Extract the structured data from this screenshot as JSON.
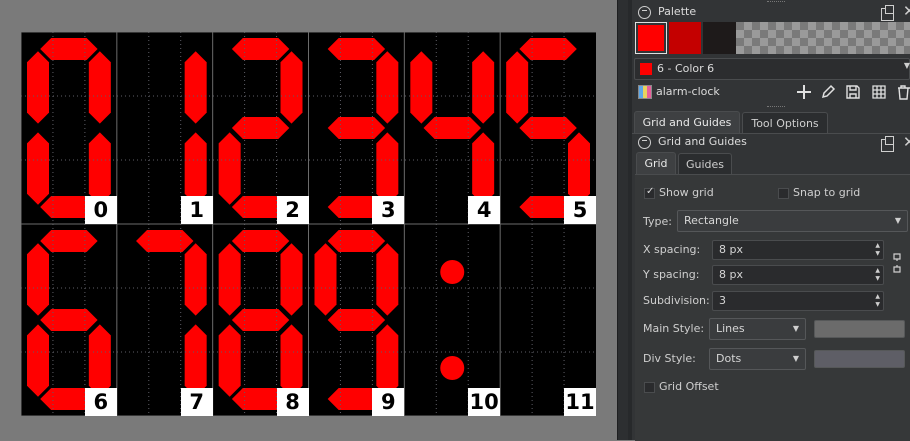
{
  "canvas": {
    "digit_color": "#ff0000",
    "background_color": "#000000",
    "labels": [
      "0",
      "1",
      "2",
      "3",
      "4",
      "5",
      "6",
      "7",
      "8",
      "9",
      "10",
      "11"
    ]
  },
  "palette_docker": {
    "title": "Palette",
    "swatches": [
      "#ff0000",
      "#c40000",
      "#1e1a1a"
    ],
    "current_color_label": "6 - Color 6",
    "current_color": "#ff0000",
    "palette_name": "alarm-clock"
  },
  "tabs_top": [
    {
      "label": "Grid and Guides",
      "active": true
    },
    {
      "label": "Tool Options",
      "active": false
    }
  ],
  "grid_docker": {
    "title": "Grid and Guides",
    "subtabs": [
      {
        "label": "Grid",
        "active": true
      },
      {
        "label": "Guides",
        "active": false
      }
    ],
    "show_grid": {
      "label": "Show grid",
      "checked": true
    },
    "snap_to_grid": {
      "label": "Snap to grid",
      "checked": false
    },
    "type": {
      "label": "Type:",
      "value": "Rectangle"
    },
    "x_spacing": {
      "label": "X spacing:",
      "value": "8 px"
    },
    "y_spacing": {
      "label": "Y spacing:",
      "value": "8 px"
    },
    "subdivision": {
      "label": "Subdivision:",
      "value": "3"
    },
    "main_style": {
      "label": "Main Style:",
      "value": "Lines",
      "color": "#6b6b6b"
    },
    "div_style": {
      "label": "Div Style:",
      "value": "Dots",
      "color": "#5e5e66"
    },
    "grid_offset": {
      "label": "Grid Offset",
      "checked": false
    }
  }
}
